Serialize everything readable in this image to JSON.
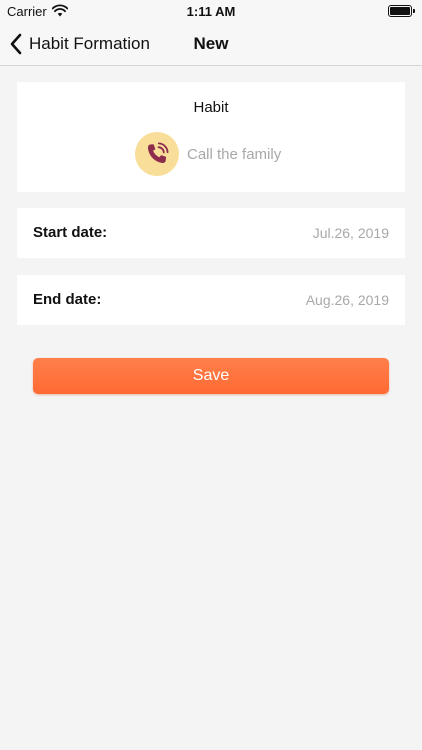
{
  "status_bar": {
    "carrier": "Carrier",
    "time": "1:11 AM"
  },
  "nav": {
    "back_label": "Habit Formation",
    "title": "New"
  },
  "habit": {
    "section_title": "Habit",
    "name": "Call the family",
    "icon": "phone-ringing-icon",
    "icon_bg": "#f9de9a",
    "icon_color": "#8e2c4e"
  },
  "start": {
    "label": "Start date:",
    "value": "Jul.26, 2019"
  },
  "end": {
    "label": "End date:",
    "value": "Aug.26, 2019"
  },
  "save": {
    "label": "Save",
    "color": "#ff7040"
  }
}
